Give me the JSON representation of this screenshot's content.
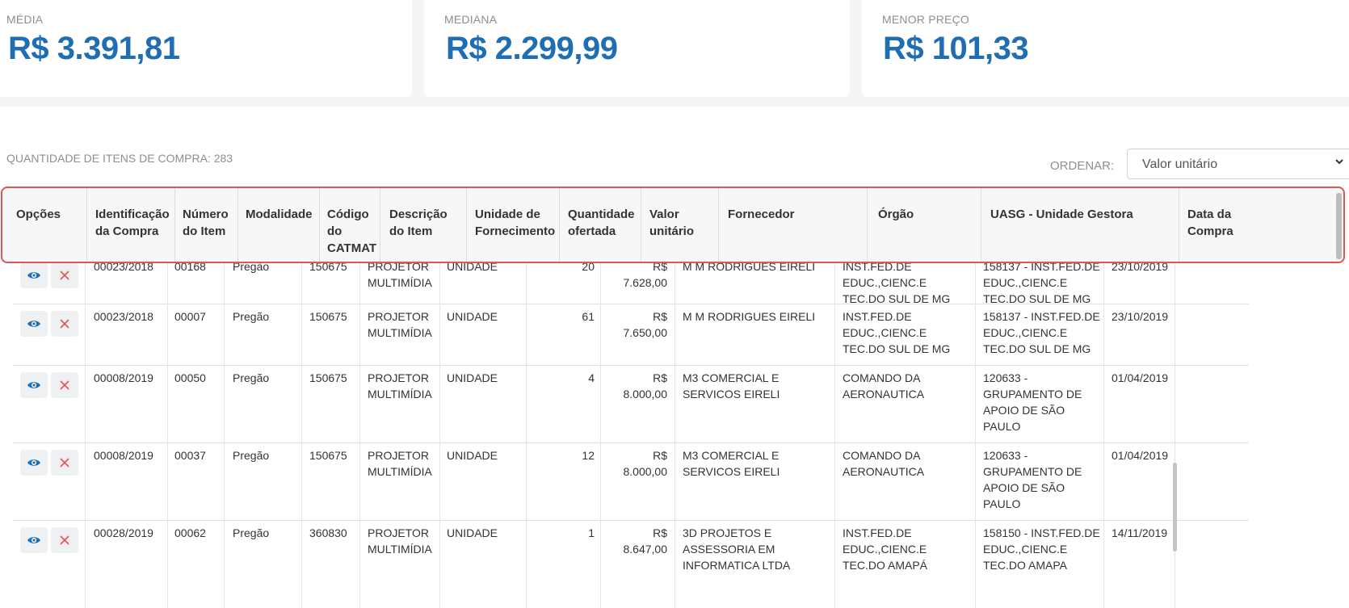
{
  "stats": [
    {
      "label": "MÉDIA",
      "value": "R$ 3.391,81"
    },
    {
      "label": "MEDIANA",
      "value": "R$ 2.299,99"
    },
    {
      "label": "MENOR PREÇO",
      "value": "R$ 101,33"
    }
  ],
  "quantity_text": "QUANTIDADE DE ITENS DE COMPRA: 283",
  "sort": {
    "label": "ORDENAR:",
    "selected": "Valor unitário"
  },
  "table": {
    "headers": [
      "Opções",
      "Identificação da Compra",
      "Número do Item",
      "Modalidade",
      "Código do CATMAT",
      "Descrição do Item",
      "Unidade de Fornecimento",
      "Quantidade ofertada",
      "Valor unitário",
      "Fornecedor",
      "Órgão",
      "UASG - Unidade Gestora",
      "Data da Compra"
    ],
    "rows": [
      {
        "id": "00023/2018",
        "item": "00168",
        "modalidade": "Pregão",
        "catmat": "150675",
        "descricao": "PROJETOR MULTIMÍDIA",
        "unidade": "UNIDADE",
        "qtd": "20",
        "valor": "R$ 7.628,00",
        "fornecedor": "M M RODRIGUES EIRELI",
        "orgao": "INST.FED.DE EDUC.,CIENC.E TEC.DO SUL DE MG",
        "uasg": "158137 - INST.FED.DE EDUC.,CIENC.E TEC.DO SUL DE MG",
        "data": "23/10/2019"
      },
      {
        "id": "00023/2018",
        "item": "00007",
        "modalidade": "Pregão",
        "catmat": "150675",
        "descricao": "PROJETOR MULTIMÍDIA",
        "unidade": "UNIDADE",
        "qtd": "61",
        "valor": "R$ 7.650,00",
        "fornecedor": "M M RODRIGUES EIRELI",
        "orgao": "INST.FED.DE EDUC.,CIENC.E TEC.DO SUL DE MG",
        "uasg": "158137 - INST.FED.DE EDUC.,CIENC.E TEC.DO SUL DE MG",
        "data": "23/10/2019"
      },
      {
        "id": "00008/2019",
        "item": "00050",
        "modalidade": "Pregão",
        "catmat": "150675",
        "descricao": "PROJETOR MULTIMÍDIA",
        "unidade": "UNIDADE",
        "qtd": "4",
        "valor": "R$ 8.000,00",
        "fornecedor": "M3 COMERCIAL E SERVICOS EIRELI",
        "orgao": "COMANDO DA AERONAUTICA",
        "uasg": "120633 - GRUPAMENTO DE APOIO DE SÃO PAULO",
        "data": "01/04/2019"
      },
      {
        "id": "00008/2019",
        "item": "00037",
        "modalidade": "Pregão",
        "catmat": "150675",
        "descricao": "PROJETOR MULTIMÍDIA",
        "unidade": "UNIDADE",
        "qtd": "12",
        "valor": "R$ 8.000,00",
        "fornecedor": "M3 COMERCIAL E SERVICOS EIRELI",
        "orgao": "COMANDO DA AERONAUTICA",
        "uasg": "120633 - GRUPAMENTO DE APOIO DE SÃO PAULO",
        "data": "01/04/2019"
      },
      {
        "id": "00028/2019",
        "item": "00062",
        "modalidade": "Pregão",
        "catmat": "360830",
        "descricao": "PROJETOR MULTIMÍDIA",
        "unidade": "UNIDADE",
        "qtd": "1",
        "valor": "R$ 8.647,00",
        "fornecedor": "3D PROJETOS E ASSESSORIA EM INFORMATICA LTDA",
        "orgao": "INST.FED.DE EDUC.,CIENC.E TEC.DO AMAPÁ",
        "uasg": "158150 - INST.FED.DE EDUC.,CIENC.E TEC.DO AMAPA",
        "data": "14/11/2019"
      }
    ]
  },
  "colors": {
    "accent": "#1f6db3",
    "highlight": "#e05555",
    "delete": "#e05555"
  },
  "icons": {
    "view": "eye-icon",
    "delete": "close-icon",
    "dropdown": "chevron-down-icon"
  }
}
